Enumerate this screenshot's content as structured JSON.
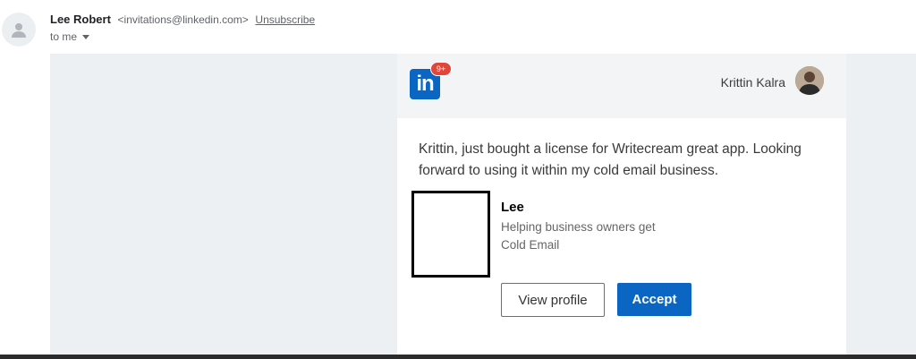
{
  "email": {
    "sender_name": "Lee Robert",
    "sender_email": "<invitations@linkedin.com>",
    "unsubscribe": "Unsubscribe",
    "to_line": "to me"
  },
  "card": {
    "logo_text": "in",
    "badge": "9+",
    "recipient_name": "Krittin Kalra",
    "message": "Krittin, just bought a license for Writecream great app. Looking forward to using it within my cold email business.",
    "profile": {
      "name": "Lee",
      "headline_line1": "Helping business owners get",
      "headline_line2": "Cold Email"
    },
    "buttons": {
      "view_profile": "View profile",
      "accept": "Accept"
    }
  },
  "colors": {
    "linkedin_blue": "#0a66c2",
    "badge_red": "#e0463a"
  }
}
